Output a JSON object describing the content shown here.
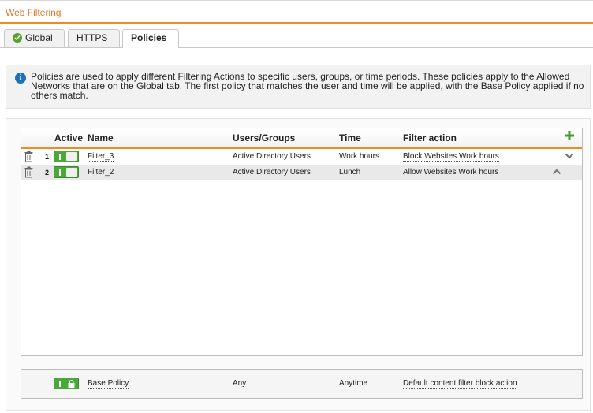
{
  "window": {
    "title": "Web Filtering"
  },
  "tabs": [
    {
      "label": "Global",
      "icon": "check-circle-icon"
    },
    {
      "label": "HTTPS"
    },
    {
      "label": "Policies"
    }
  ],
  "info": {
    "text": "Policies are used to apply different Filtering Actions to specific users, groups, or time periods. These policies apply to the Allowed Networks that are on the Global tab. The first policy that matches the user and time will be applied, with the Base Policy applied if no others match."
  },
  "table": {
    "headers": {
      "active": "Active",
      "name": "Name",
      "users": "Users/Groups",
      "time": "Time",
      "filter": "Filter action"
    },
    "rows": [
      {
        "index": "1",
        "name": "Filter_3",
        "users": "Active Directory Users",
        "time": "Work hours",
        "filter": "Block Websites Work hours",
        "active": true
      },
      {
        "index": "2",
        "name": "Filter_2",
        "users": "Active Directory Users",
        "time": "Lunch",
        "filter": "Allow Websites Work hours",
        "active": true
      }
    ]
  },
  "base_policy": {
    "name": "Base Policy",
    "users": "Any",
    "time": "Anytime",
    "filter": "Default content filter block action",
    "active": true
  },
  "colors": {
    "accent": "#f08a24",
    "toggle": "#4aa838",
    "info": "#1d6fb8",
    "title": "#e8762c"
  }
}
